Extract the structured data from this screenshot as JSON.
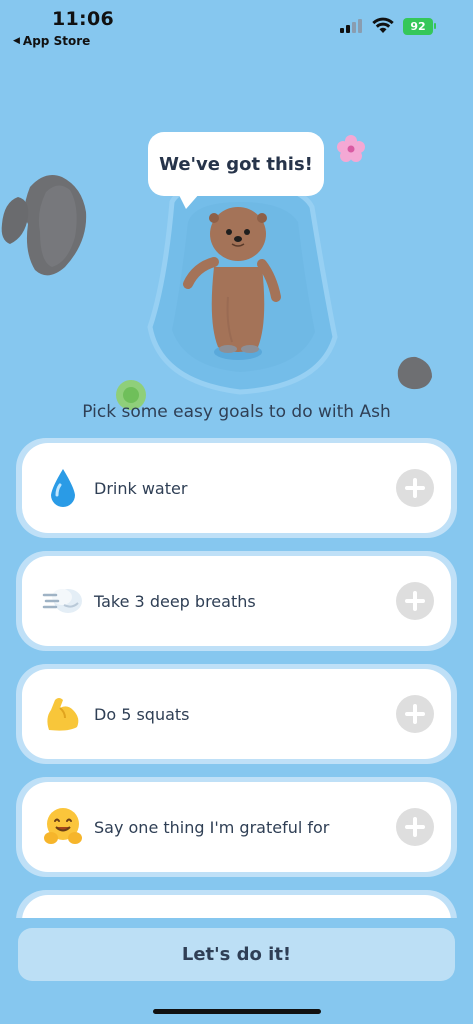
{
  "status_bar": {
    "time": "11:06",
    "back_app": "App Store",
    "battery": "92"
  },
  "scene": {
    "speech": "We've got this!"
  },
  "prompt": "Pick some easy goals to do with Ash",
  "goals": [
    {
      "label": "Drink water",
      "icon": "water-drop-icon"
    },
    {
      "label": "Take 3 deep breaths",
      "icon": "wind-icon"
    },
    {
      "label": "Do 5 squats",
      "icon": "flexed-bicep-icon"
    },
    {
      "label": "Say one thing I'm grateful for",
      "icon": "hugging-face-icon"
    }
  ],
  "cta": "Let's do it!",
  "colors": {
    "background": "#86c7ef",
    "card_border": "#bfe0f7",
    "button": "#bcdff5",
    "battery": "#35c759"
  }
}
